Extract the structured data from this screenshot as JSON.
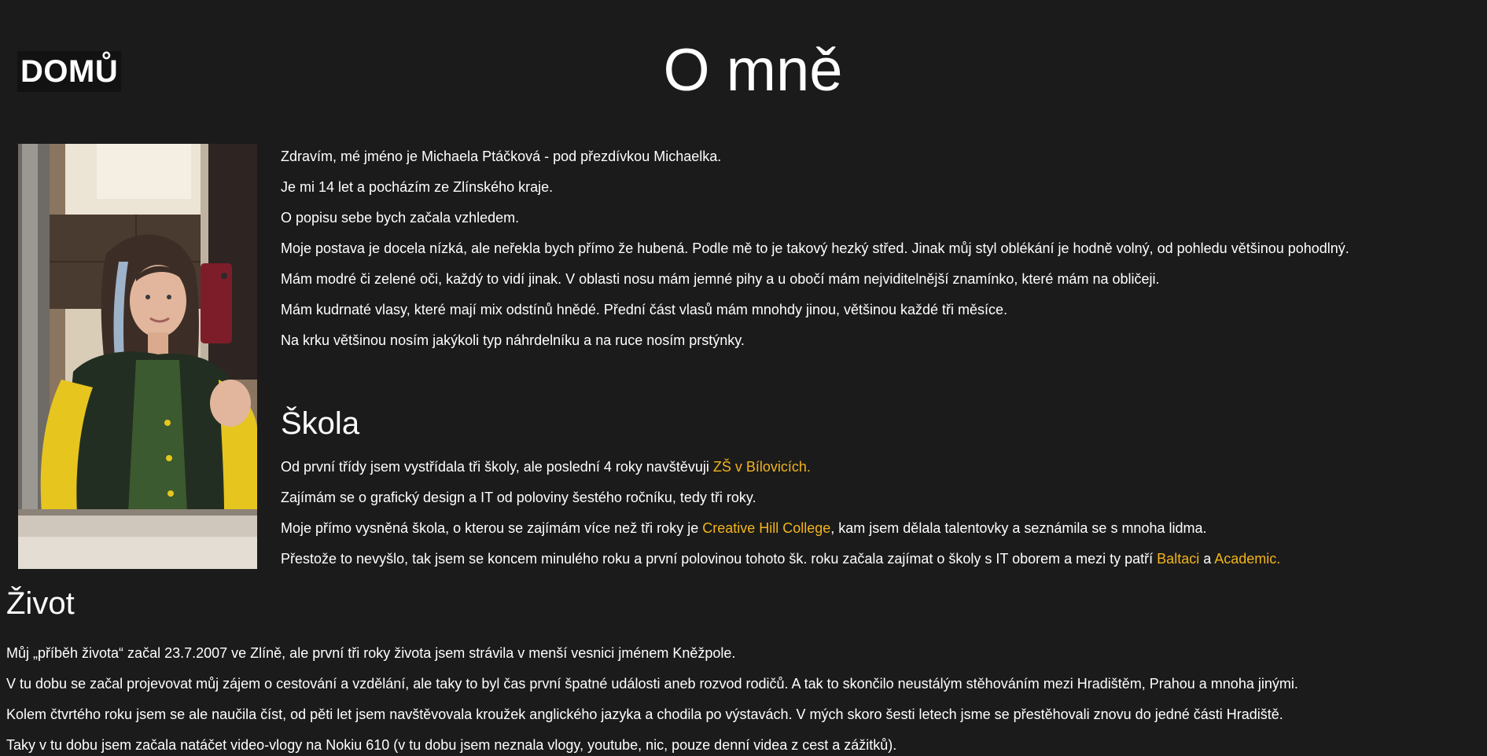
{
  "nav": {
    "home_label": "DOMŮ"
  },
  "page_title": "O mně",
  "photo": {
    "alt": "Selfie v zrcadle"
  },
  "about": {
    "paragraphs": [
      "Zdravím, mé jméno je Michaela Ptáčková - pod přezdívkou Michaelka.",
      "Je mi 14 let a pocházím ze Zlínského kraje.",
      "O popisu sebe bych začala vzhledem.",
      "Moje postava je docela nízká, ale neřekla bych přímo že hubená. Podle mě to je takový hezký střed. Jinak můj styl oblékání je hodně volný, od pohledu většinou pohodlný.",
      "Mám modré či zelené oči, každý to vidí jinak. V oblasti nosu mám jemné pihy a u obočí mám nejviditelnější znamínko, které mám na obličeji.",
      "Mám kudrnaté vlasy, které mají mix odstínů hnědé. Přední část vlasů mám mnohdy jinou, většinou každé tři měsíce.",
      "Na krku většinou nosím jakýkoli typ náhrdelníku a na ruce nosím prstýnky."
    ]
  },
  "school": {
    "title": "Škola",
    "p1_text": "Od první třídy jsem vystřídala tři školy, ale poslední 4 roky navštěvuji ",
    "p1_link": "ZŠ v Bílovicích.",
    "p2_text": "Zajímám se o grafický design a IT od poloviny šestého ročníku, tedy tři roky.",
    "p3_text": "Moje přímo vysněná škola, o kterou se zajímám více než tři roky je ",
    "p3_link": "Creative Hill College",
    "p3_after": ", kam jsem dělala talentovky a seznámila se s mnoha lidma.",
    "p4_text": "Přestože to nevyšlo, tak jsem se koncem minulého roku a první polovinou tohoto šk. roku začala zajímat o školy s IT oborem a mezi ty patří ",
    "p4_link1": "Baltaci",
    "p4_mid": " a ",
    "p4_link2": "Academic."
  },
  "life": {
    "title": "Život",
    "paragraphs": [
      "Můj „příběh života“ začal 23.7.2007 ve Zlíně, ale první tři roky života jsem strávila v menší vesnici jménem Kněžpole.",
      "V tu dobu se začal projevovat můj zájem o cestování a vzdělání, ale taky to byl čas první špatné události aneb rozvod rodičů. A tak to skončilo neustálým stěhováním mezi Hradištěm, Prahou a mnoha jinými.",
      "Kolem čtvrtého roku jsem se ale naučila číst, od pěti let jsem navštěvovala kroužek anglického jazyka a chodila po výstavách. V mých skoro šesti letech jsme se přestěhovali znovu do jedné části Hradiště.",
      "Taky v tu dobu jsem začala natáčet video-vlogy na Nokiu 610 (v tu dobu jsem neznala vlogy, youtube, nic, pouze denní videa z cest a zážitků)."
    ]
  },
  "colors": {
    "background": "#1b1b1b",
    "text": "#ffffff",
    "link": "#f2b41c"
  }
}
